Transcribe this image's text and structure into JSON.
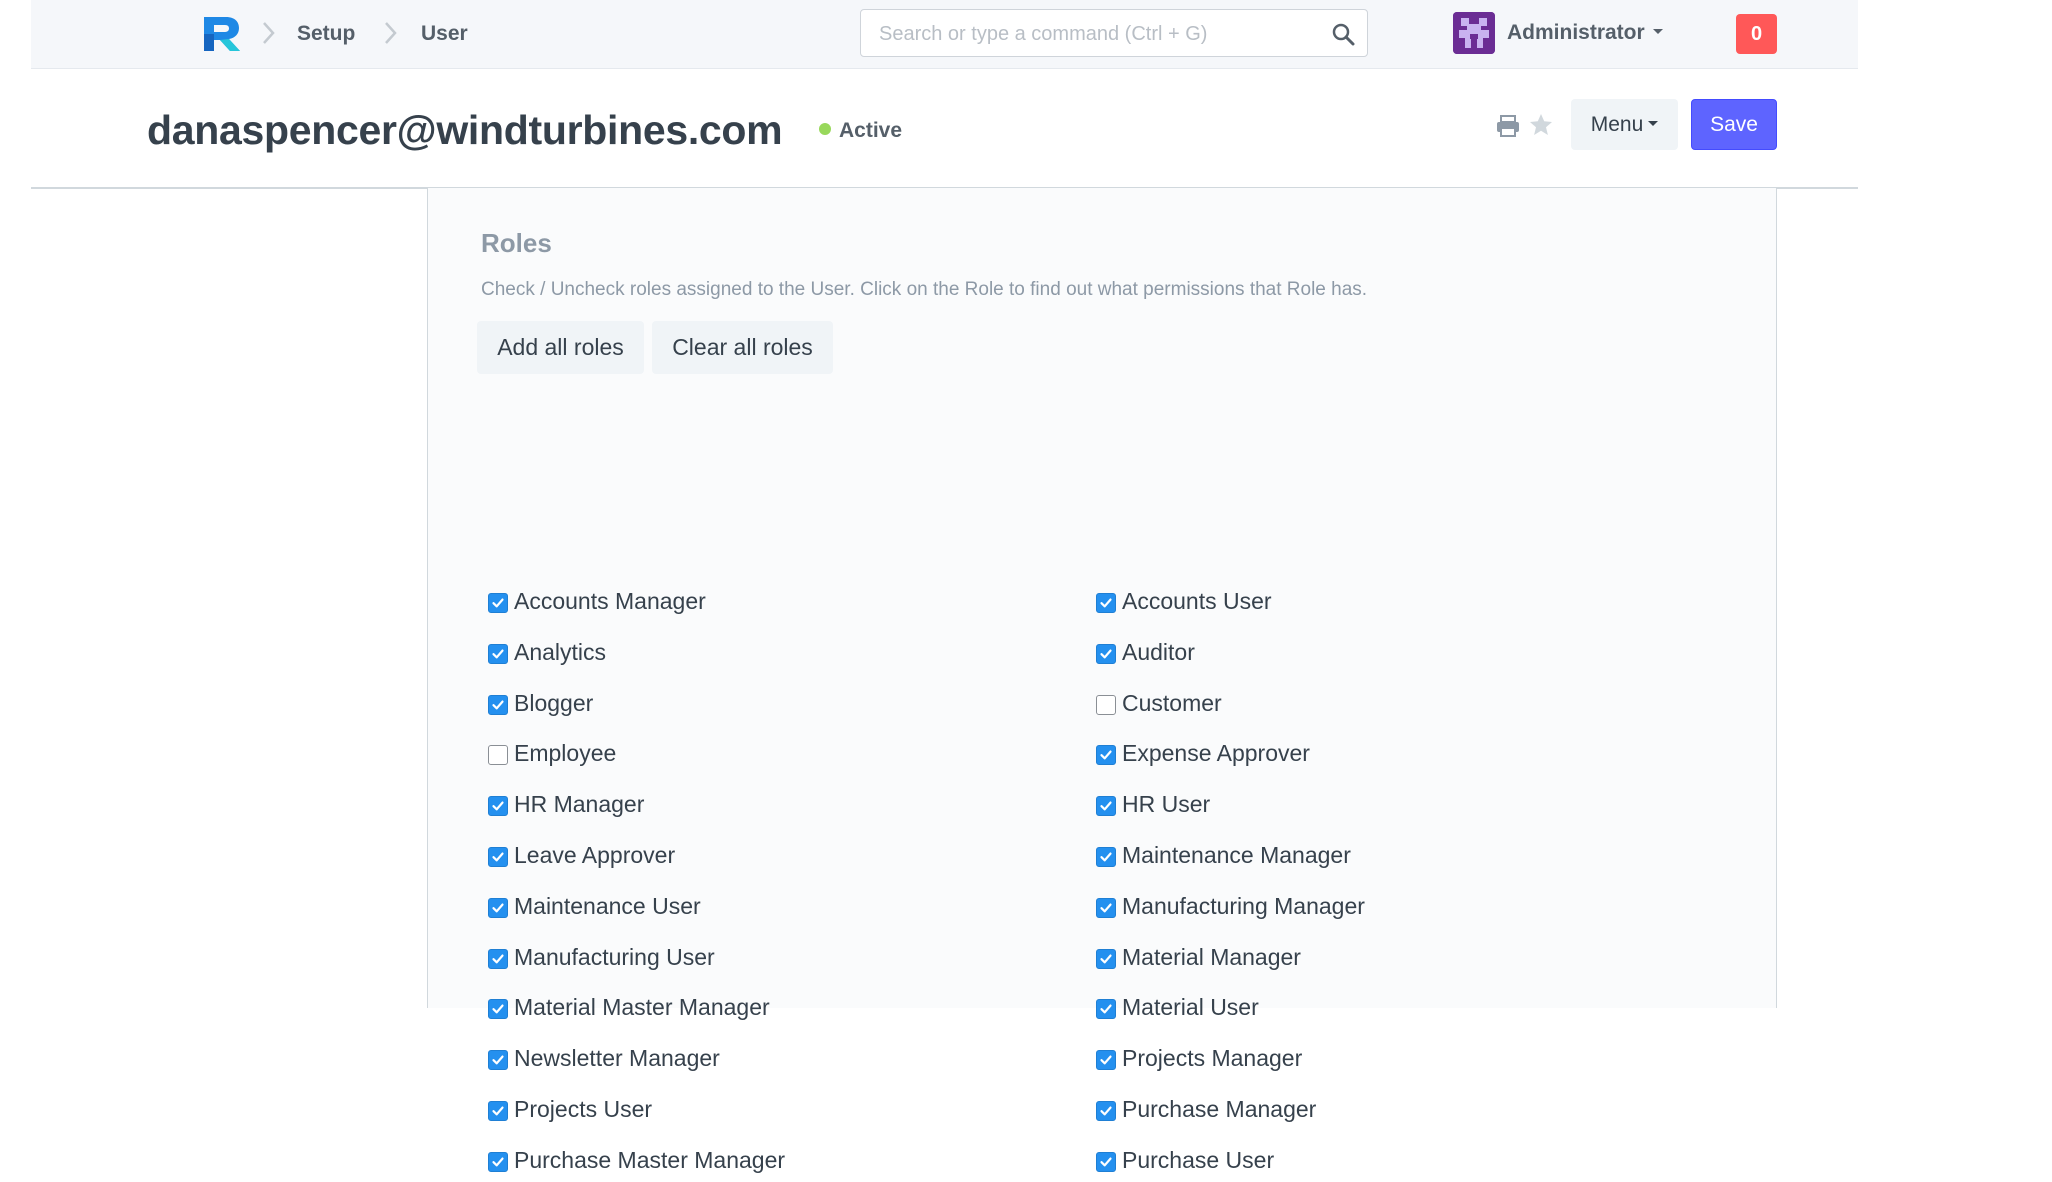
{
  "navbar": {
    "breadcrumbs": [
      "Setup",
      "User"
    ],
    "search_placeholder": "Search or type a command (Ctrl + G)",
    "user_name": "Administrator",
    "notification_count": "0"
  },
  "page": {
    "title": "danaspencer@windturbines.com",
    "status": "Active",
    "status_color": "#98d85b",
    "menu_label": "Menu",
    "save_label": "Save",
    "accent_color": "#5e64ff"
  },
  "roles": {
    "title": "Roles",
    "help": "Check / Uncheck roles assigned to the User. Click on the Role to find out what permissions that Role has.",
    "add_all_label": "Add all roles",
    "clear_all_label": "Clear all roles",
    "items": [
      {
        "label": "Accounts Manager",
        "checked": true
      },
      {
        "label": "Accounts User",
        "checked": true
      },
      {
        "label": "Analytics",
        "checked": true
      },
      {
        "label": "Auditor",
        "checked": true
      },
      {
        "label": "Blogger",
        "checked": true
      },
      {
        "label": "Customer",
        "checked": false
      },
      {
        "label": "Employee",
        "checked": false
      },
      {
        "label": "Expense Approver",
        "checked": true
      },
      {
        "label": "HR Manager",
        "checked": true
      },
      {
        "label": "HR User",
        "checked": true
      },
      {
        "label": "Leave Approver",
        "checked": true
      },
      {
        "label": "Maintenance Manager",
        "checked": true
      },
      {
        "label": "Maintenance User",
        "checked": true
      },
      {
        "label": "Manufacturing Manager",
        "checked": true
      },
      {
        "label": "Manufacturing User",
        "checked": true
      },
      {
        "label": "Material Manager",
        "checked": true
      },
      {
        "label": "Material Master Manager",
        "checked": true
      },
      {
        "label": "Material User",
        "checked": true
      },
      {
        "label": "Newsletter Manager",
        "checked": true
      },
      {
        "label": "Projects Manager",
        "checked": true
      },
      {
        "label": "Projects User",
        "checked": true
      },
      {
        "label": "Purchase Manager",
        "checked": true
      },
      {
        "label": "Purchase Master Manager",
        "checked": true
      },
      {
        "label": "Purchase User",
        "checked": true
      }
    ]
  }
}
